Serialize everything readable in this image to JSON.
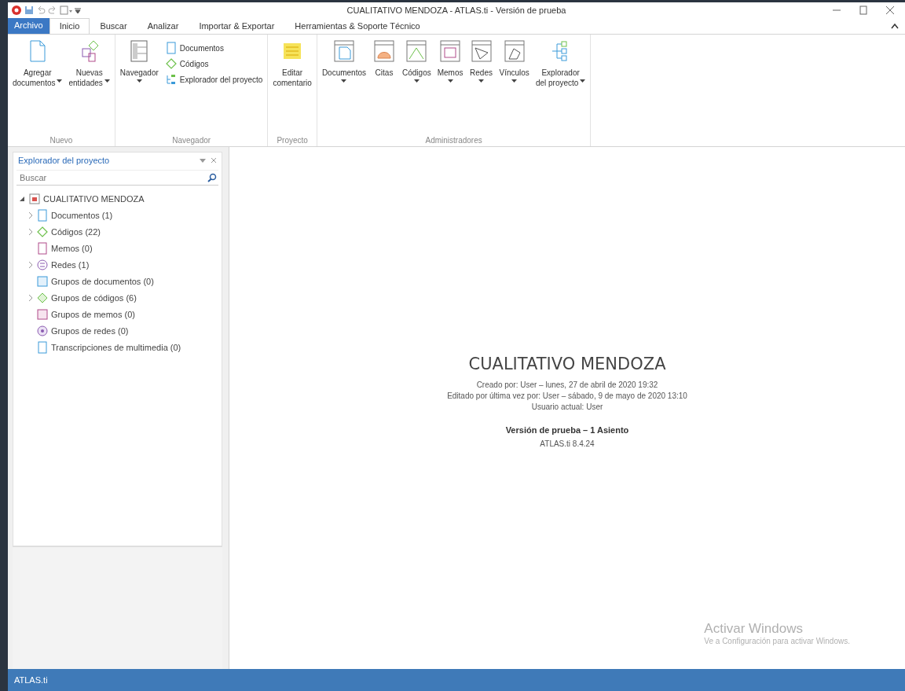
{
  "window": {
    "title": "CUALITATIVO MENDOZA - ATLAS.ti - Versión de prueba"
  },
  "ribbon_tabs": [
    {
      "label": "Archivo",
      "kind": "file",
      "selected": false
    },
    {
      "label": "Inicio",
      "kind": "tab",
      "selected": true
    },
    {
      "label": "Buscar",
      "kind": "tab",
      "selected": false
    },
    {
      "label": "Analizar",
      "kind": "tab",
      "selected": false
    },
    {
      "label": "Importar & Exportar",
      "kind": "tab",
      "selected": false
    },
    {
      "label": "Herramientas & Soporte Técnico",
      "kind": "tab",
      "selected": false
    }
  ],
  "ribbon_groups": [
    {
      "label": "Nuevo",
      "commands": [
        {
          "kind": "large",
          "lines": [
            "Agregar",
            "documentos"
          ],
          "dropdown": true
        },
        {
          "kind": "large",
          "lines": [
            "Nuevas",
            "entidades"
          ],
          "dropdown": true
        }
      ]
    },
    {
      "label": "Navegador",
      "commands": [
        {
          "kind": "large",
          "lines": [
            "Navegador"
          ],
          "dropdown": true
        },
        {
          "kind": "stack",
          "items": [
            {
              "label": "Documentos"
            },
            {
              "label": "Códigos"
            },
            {
              "label": "Explorador del proyecto"
            }
          ]
        }
      ]
    },
    {
      "label": "Proyecto",
      "commands": [
        {
          "kind": "large",
          "lines": [
            "Editar",
            "comentario"
          ],
          "dropdown": false
        }
      ]
    },
    {
      "label": "Administradores",
      "commands": [
        {
          "kind": "large",
          "lines": [
            "Documentos"
          ],
          "dropdown": true
        },
        {
          "kind": "large",
          "lines": [
            "Citas"
          ],
          "dropdown": false
        },
        {
          "kind": "large",
          "lines": [
            "Códigos"
          ],
          "dropdown": true
        },
        {
          "kind": "large",
          "lines": [
            "Memos"
          ],
          "dropdown": true
        },
        {
          "kind": "large",
          "lines": [
            "Redes"
          ],
          "dropdown": true
        },
        {
          "kind": "large",
          "lines": [
            "Vínculos"
          ],
          "dropdown": true
        },
        {
          "kind": "large",
          "lines": [
            "Explorador",
            "del proyecto"
          ],
          "dropdown": true
        }
      ]
    }
  ],
  "explorer": {
    "title": "Explorador del proyecto",
    "search": {
      "placeholder": "Buscar"
    },
    "tree": [
      {
        "label": "CUALITATIVO MENDOZA",
        "expandable": true,
        "expanded": true,
        "children": [
          {
            "label": "Documentos (1)",
            "expandable": true,
            "expanded": false
          },
          {
            "label": "Códigos (22)",
            "expandable": true,
            "expanded": false
          },
          {
            "label": "Memos (0)",
            "expandable": false
          },
          {
            "label": "Redes (1)",
            "expandable": true,
            "expanded": false
          },
          {
            "label": "Grupos de documentos (0)",
            "expandable": false
          },
          {
            "label": "Grupos de códigos (6)",
            "expandable": true,
            "expanded": false
          },
          {
            "label": "Grupos de memos (0)",
            "expandable": false
          },
          {
            "label": "Grupos de redes (0)",
            "expandable": false
          },
          {
            "label": "Transcripciones de multimedia (0)",
            "expandable": false
          }
        ]
      }
    ]
  },
  "project_info": {
    "name": "CUALITATIVO MENDOZA",
    "details": [
      "Creado por: User – lunes, 27 de abril de 2020 19:32",
      "Editado por última vez por: User – sábado, 9 de mayo de 2020 13:10",
      "Usuario actual: User"
    ],
    "license": "Versión de prueba – 1 Asiento",
    "version": "ATLAS.ti 8.4.24"
  },
  "activation_notice": {
    "title": "Activar Windows",
    "text": "Ve a Configuración para activar Windows."
  },
  "status_bar": {
    "text": "ATLAS.ti"
  }
}
